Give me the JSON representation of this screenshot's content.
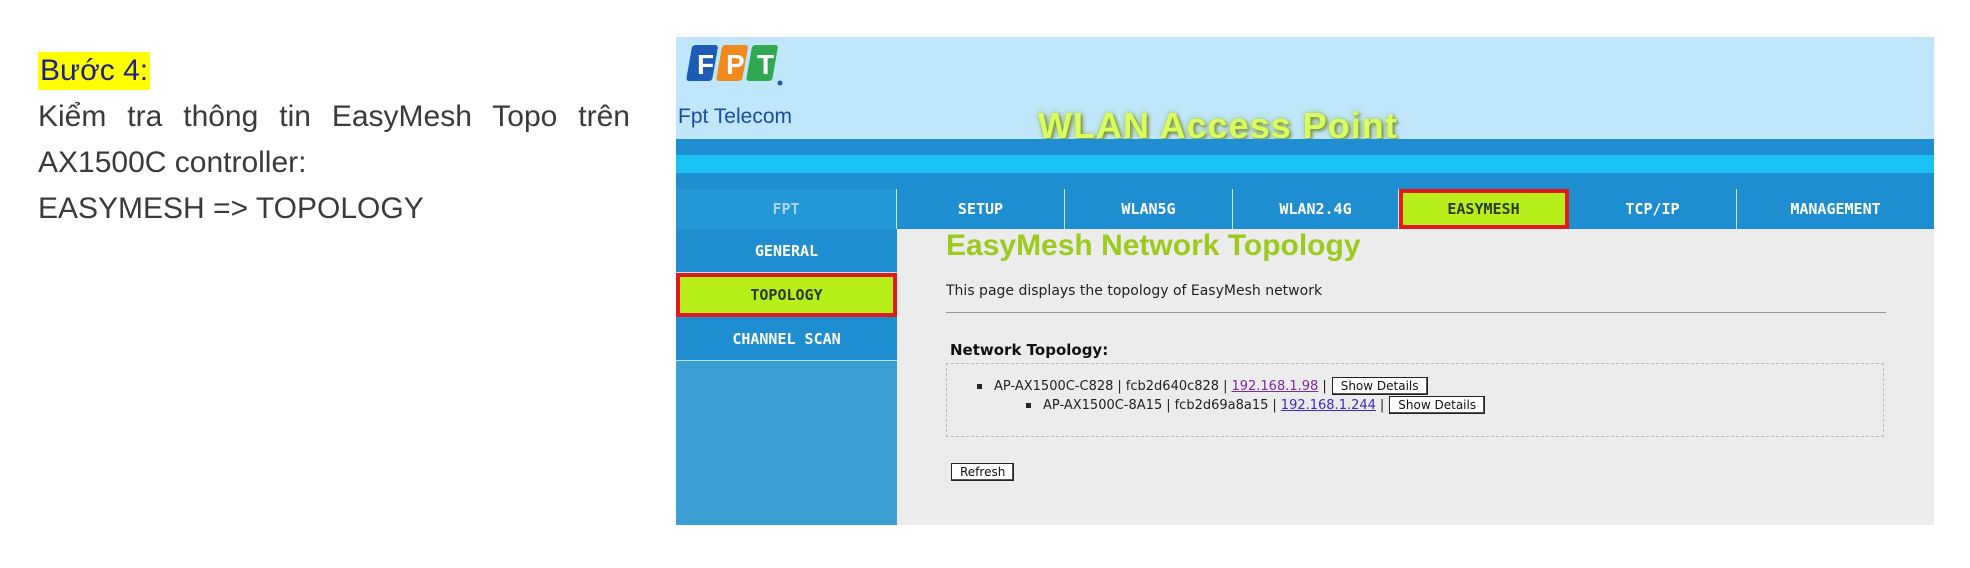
{
  "instructions": {
    "title": "Bước 4:",
    "line1": "Kiểm tra thông tin EasyMesh Topo trên",
    "line2": "AX1500C controller:",
    "line3": "EASYMESH => TOPOLOGY"
  },
  "header": {
    "logo_text": "Fpt Telecom",
    "title": "WLAN Access Point",
    "logo_colors": [
      "#1e5bb5",
      "#f08a1c",
      "#2fa84f"
    ]
  },
  "top_nav": {
    "brand": "FPT",
    "items": [
      "SETUP",
      "WLAN5G",
      "WLAN2.4G",
      "EASYMESH",
      "TCP/IP",
      "MANAGEMENT"
    ],
    "active": "EASYMESH"
  },
  "side_nav": {
    "items": [
      "GENERAL",
      "TOPOLOGY",
      "CHANNEL SCAN"
    ],
    "active": "TOPOLOGY"
  },
  "main": {
    "title": "EasyMesh Network Topology",
    "description": "This page displays the topology of EasyMesh network",
    "section_label": "Network Topology:",
    "nodes": [
      {
        "name": "AP-AX1500C-C828",
        "mac": "fcb2d640c828",
        "ip": "192.168.1.98",
        "button": "Show Details"
      },
      {
        "name": "AP-AX1500C-8A15",
        "mac": "fcb2d69a8a15",
        "ip": "192.168.1.244",
        "button": "Show Details"
      }
    ],
    "separator": "|",
    "refresh_label": "Refresh"
  },
  "colors": {
    "highlight": "#ffff00",
    "active_tab": "#b8ef1a",
    "callout_border": "#e01a1a",
    "nav_blue": "#1e8ed0",
    "title_green": "#9ccb1e"
  }
}
